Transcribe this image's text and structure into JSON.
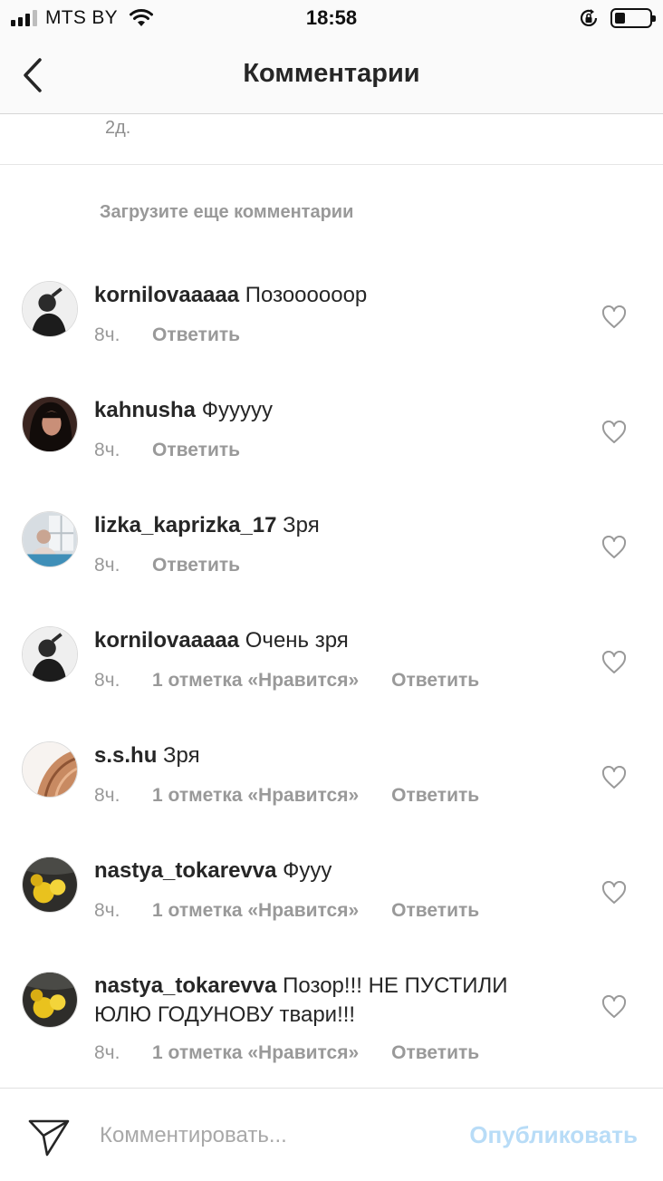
{
  "status_bar": {
    "carrier": "MTS BY",
    "time": "18:58",
    "battery_level": 0.3
  },
  "header": {
    "title": "Комментарии"
  },
  "caption": {
    "time": "2д."
  },
  "load_more_label": "Загрузите еще комментарии",
  "comments": [
    {
      "username": "kornilovaaaaa",
      "text": "Позоооооор",
      "time": "8ч.",
      "likes": "",
      "reply_label": "Ответить",
      "avatar_icon": "portrait-dark-hood-icon"
    },
    {
      "username": "kahnusha",
      "text": "Фууууу",
      "time": "8ч.",
      "likes": "",
      "reply_label": "Ответить",
      "avatar_icon": "portrait-dark-hair-icon"
    },
    {
      "username": "lizka_kaprizka_17",
      "text": "Зря",
      "time": "8ч.",
      "likes": "",
      "reply_label": "Ответить",
      "avatar_icon": "photo-window-icon"
    },
    {
      "username": "kornilovaaaaa",
      "text": "Очень зря",
      "time": "8ч.",
      "likes": "1 отметка «Нравится»",
      "reply_label": "Ответить",
      "avatar_icon": "portrait-dark-hood-icon"
    },
    {
      "username": "s.s.hu",
      "text": "Зря",
      "time": "8ч.",
      "likes": "1 отметка «Нравится»",
      "reply_label": "Ответить",
      "avatar_icon": "hair-photo-icon"
    },
    {
      "username": "nastya_tokarevva",
      "text": "Фууу",
      "time": "8ч.",
      "likes": "1 отметка «Нравится»",
      "reply_label": "Ответить",
      "avatar_icon": "yellow-flowers-icon"
    },
    {
      "username": "nastya_tokarevva",
      "text": "Позор!!! НЕ ПУСТИЛИ ЮЛЮ ГОДУНОВУ твари!!!",
      "time": "8ч.",
      "likes": "1 отметка «Нравится»",
      "reply_label": "Ответить",
      "avatar_icon": "yellow-flowers-icon"
    }
  ],
  "comment_bar": {
    "placeholder": "Комментировать...",
    "publish_label": "Опубликовать"
  },
  "colors": {
    "text": "#262626",
    "secondary": "#999999",
    "publish_disabled": "#b8dcf7",
    "bar_background": "#fafafa"
  }
}
